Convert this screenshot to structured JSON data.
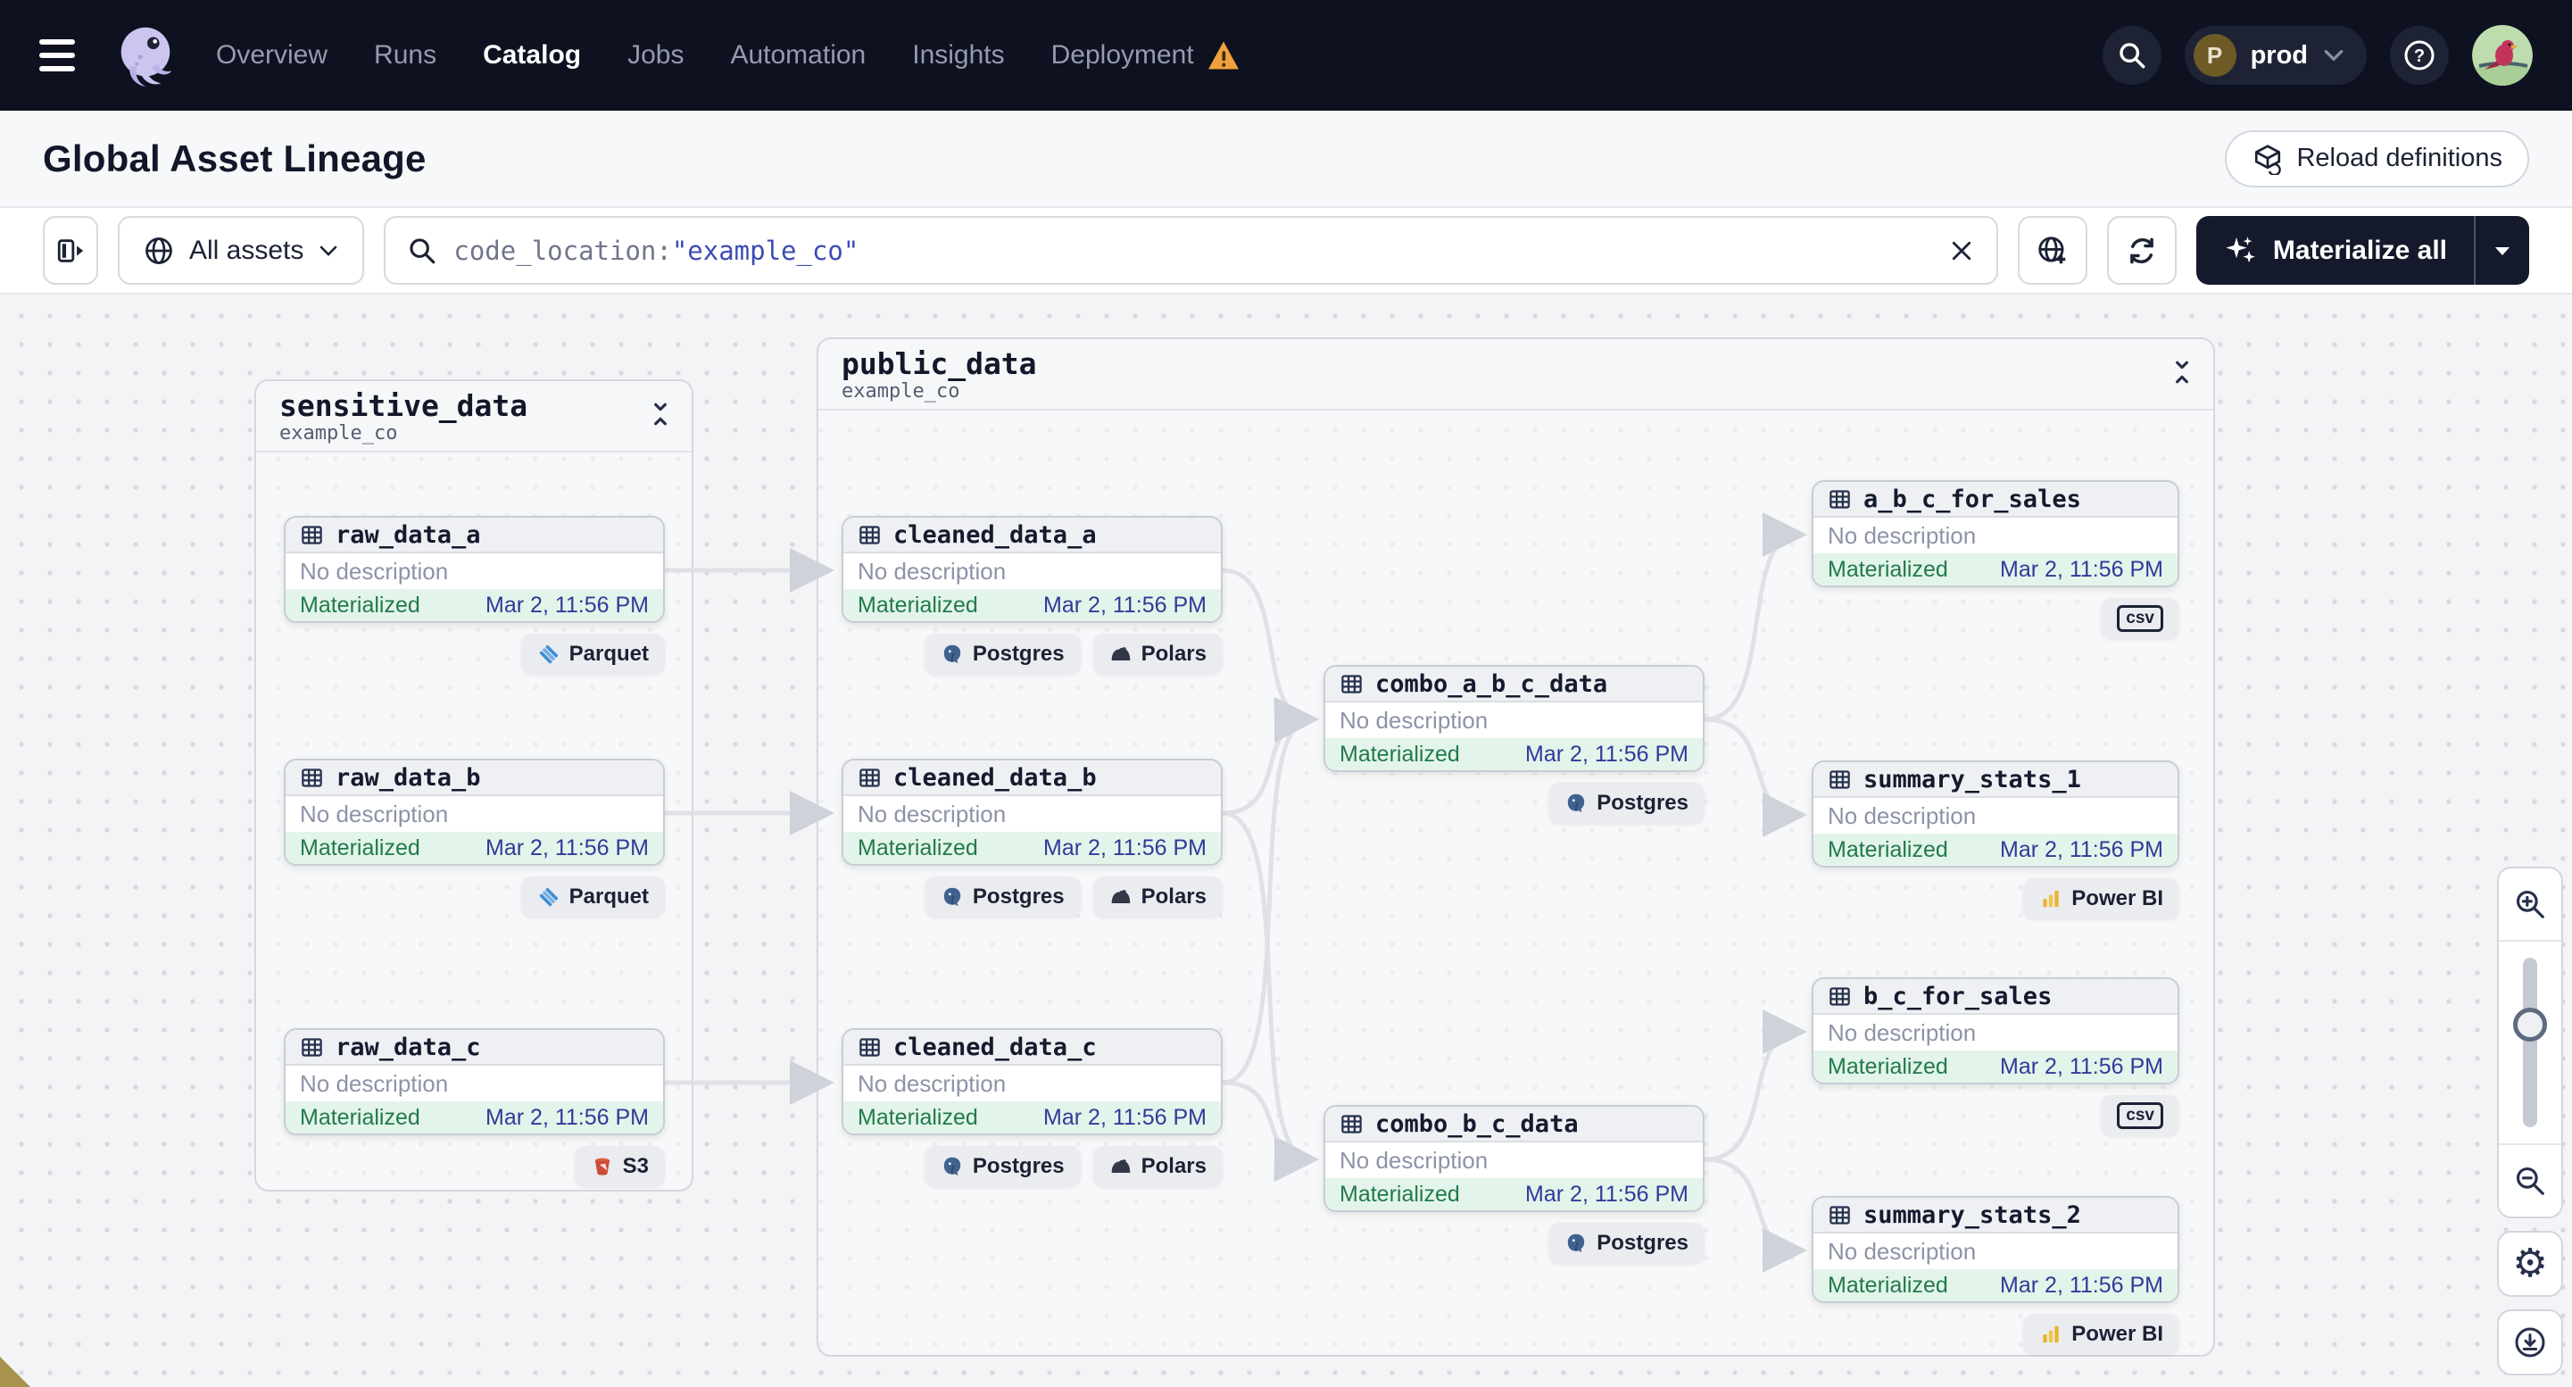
{
  "nav": {
    "items": [
      "Overview",
      "Runs",
      "Catalog",
      "Jobs",
      "Automation",
      "Insights",
      "Deployment"
    ],
    "active_item": "Catalog",
    "environment": {
      "initial": "P",
      "name": "prod"
    }
  },
  "page_header": {
    "title": "Global Asset Lineage",
    "reload_button_label": "Reload definitions"
  },
  "toolbar": {
    "scope_button_label": "All assets",
    "search_prefix": "code_location:",
    "search_quoted": "\"example_co\"",
    "materialize_button_label": "Materialize all"
  },
  "colors": {
    "nav_bg": "#0d1120",
    "accent_dark": "#141a2c",
    "materialized_green": "#217a4b",
    "timestamp_blue": "#2f3b99",
    "warning_orange": "#f0a03c"
  },
  "graph": {
    "groups": [
      {
        "name": "sensitive_data",
        "location": "example_co"
      },
      {
        "name": "public_data",
        "location": "example_co"
      }
    ],
    "nodes": [
      {
        "name": "raw_data_a",
        "description": "No description",
        "status": "Materialized",
        "timestamp": "Mar 2, 11:56 PM",
        "tags": [
          "Parquet"
        ]
      },
      {
        "name": "raw_data_b",
        "description": "No description",
        "status": "Materialized",
        "timestamp": "Mar 2, 11:56 PM",
        "tags": [
          "Parquet"
        ]
      },
      {
        "name": "raw_data_c",
        "description": "No description",
        "status": "Materialized",
        "timestamp": "Mar 2, 11:56 PM",
        "tags": [
          "S3"
        ]
      },
      {
        "name": "cleaned_data_a",
        "description": "No description",
        "status": "Materialized",
        "timestamp": "Mar 2, 11:56 PM",
        "tags": [
          "Postgres",
          "Polars"
        ]
      },
      {
        "name": "cleaned_data_b",
        "description": "No description",
        "status": "Materialized",
        "timestamp": "Mar 2, 11:56 PM",
        "tags": [
          "Postgres",
          "Polars"
        ]
      },
      {
        "name": "cleaned_data_c",
        "description": "No description",
        "status": "Materialized",
        "timestamp": "Mar 2, 11:56 PM",
        "tags": [
          "Postgres",
          "Polars"
        ]
      },
      {
        "name": "combo_a_b_c_data",
        "description": "No description",
        "status": "Materialized",
        "timestamp": "Mar 2, 11:56 PM",
        "tags": [
          "Postgres"
        ]
      },
      {
        "name": "a_b_c_for_sales",
        "description": "No description",
        "status": "Materialized",
        "timestamp": "Mar 2, 11:56 PM",
        "tags": [
          "csv"
        ]
      },
      {
        "name": "summary_stats_1",
        "description": "No description",
        "status": "Materialized",
        "timestamp": "Mar 2, 11:56 PM",
        "tags": [
          "Power BI"
        ]
      },
      {
        "name": "combo_b_c_data",
        "description": "No description",
        "status": "Materialized",
        "timestamp": "Mar 2, 11:56 PM",
        "tags": [
          "Postgres"
        ]
      },
      {
        "name": "b_c_for_sales",
        "description": "No description",
        "status": "Materialized",
        "timestamp": "Mar 2, 11:56 PM",
        "tags": [
          "csv"
        ]
      },
      {
        "name": "summary_stats_2",
        "description": "No description",
        "status": "Materialized",
        "timestamp": "Mar 2, 11:56 PM",
        "tags": [
          "Power BI"
        ]
      }
    ]
  }
}
